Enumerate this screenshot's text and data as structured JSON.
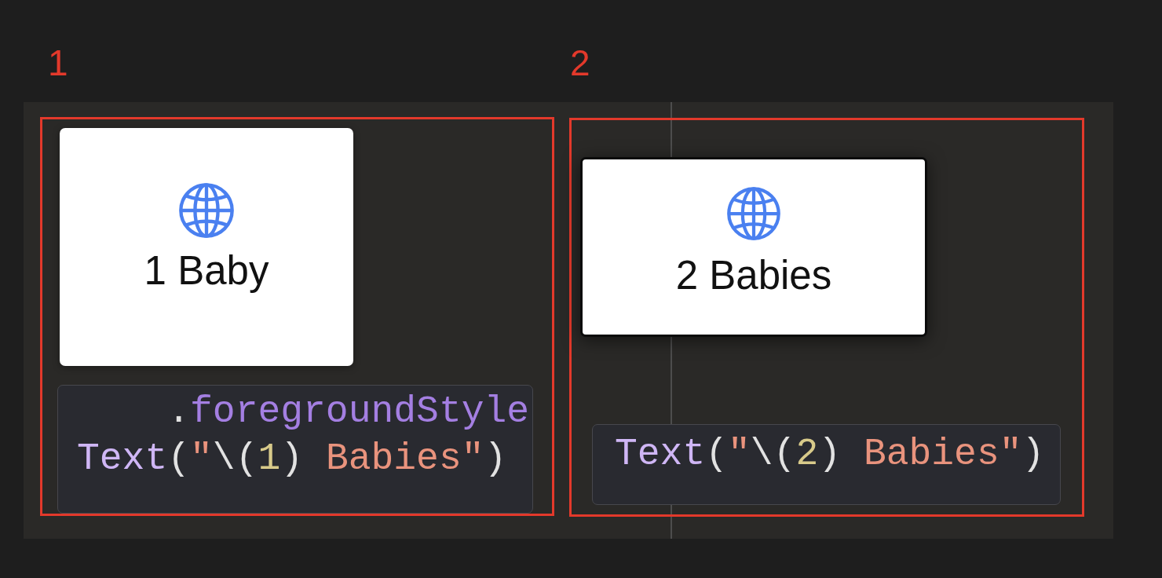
{
  "panels": [
    {
      "number": "1",
      "preview": {
        "title": "1 Baby",
        "framed": false
      },
      "code": {
        "lines": [
          {
            "tokens": [
              {
                "kind": "plain",
                "text": "    ."
              },
              {
                "kind": "method",
                "text": "foregroundStyle"
              }
            ]
          },
          {
            "tokens": [
              {
                "kind": "type",
                "text": "Text"
              },
              {
                "kind": "plain",
                "text": "("
              },
              {
                "kind": "string",
                "text": "\""
              },
              {
                "kind": "plain",
                "text": "\\("
              },
              {
                "kind": "number",
                "text": "1"
              },
              {
                "kind": "plain",
                "text": ")"
              },
              {
                "kind": "string",
                "text": " Babies\""
              },
              {
                "kind": "plain",
                "text": ")"
              }
            ]
          }
        ]
      }
    },
    {
      "number": "2",
      "preview": {
        "title": "2 Babies",
        "framed": true
      },
      "code": {
        "lines": [
          {
            "tokens": [
              {
                "kind": "type",
                "text": "Text"
              },
              {
                "kind": "plain",
                "text": "("
              },
              {
                "kind": "string",
                "text": "\""
              },
              {
                "kind": "plain",
                "text": "\\("
              },
              {
                "kind": "number",
                "text": "2"
              },
              {
                "kind": "plain",
                "text": ")"
              },
              {
                "kind": "string",
                "text": " Babies\""
              },
              {
                "kind": "plain",
                "text": ")"
              }
            ]
          }
        ]
      }
    }
  ]
}
